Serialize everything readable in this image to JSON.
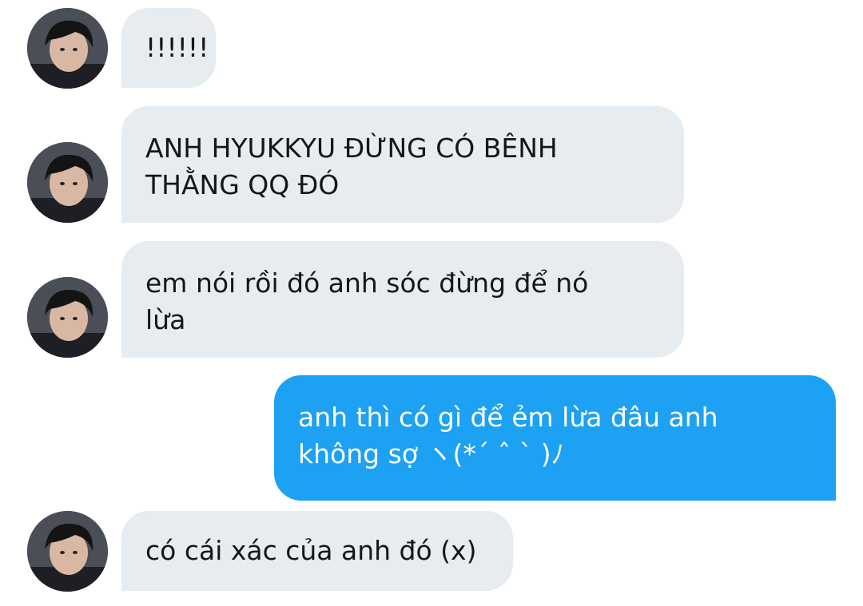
{
  "conversation": {
    "messages": [
      {
        "direction": "incoming",
        "text": "!!!!!!"
      },
      {
        "direction": "incoming",
        "text": "ANH HYUKKYU ĐỪNG CÓ BÊNH\nTHẰNG QQ ĐÓ"
      },
      {
        "direction": "incoming",
        "text": "em nói rồi đó anh sóc đừng để nó\nlừa"
      },
      {
        "direction": "outgoing",
        "text": "anh thì có gì để ẻm lừa đâu anh\nkhông sợ ヽ(*´ ˆ ˋ )ﾉ"
      },
      {
        "direction": "incoming",
        "text": "có cái xác của anh đó (x)"
      }
    ]
  },
  "colors": {
    "incoming_bubble": "#e6ecf0",
    "outgoing_bubble": "#1da1f2",
    "incoming_text": "#14171a",
    "outgoing_text": "#ffffff"
  },
  "icons": {
    "avatar": "user-profile-photo"
  }
}
